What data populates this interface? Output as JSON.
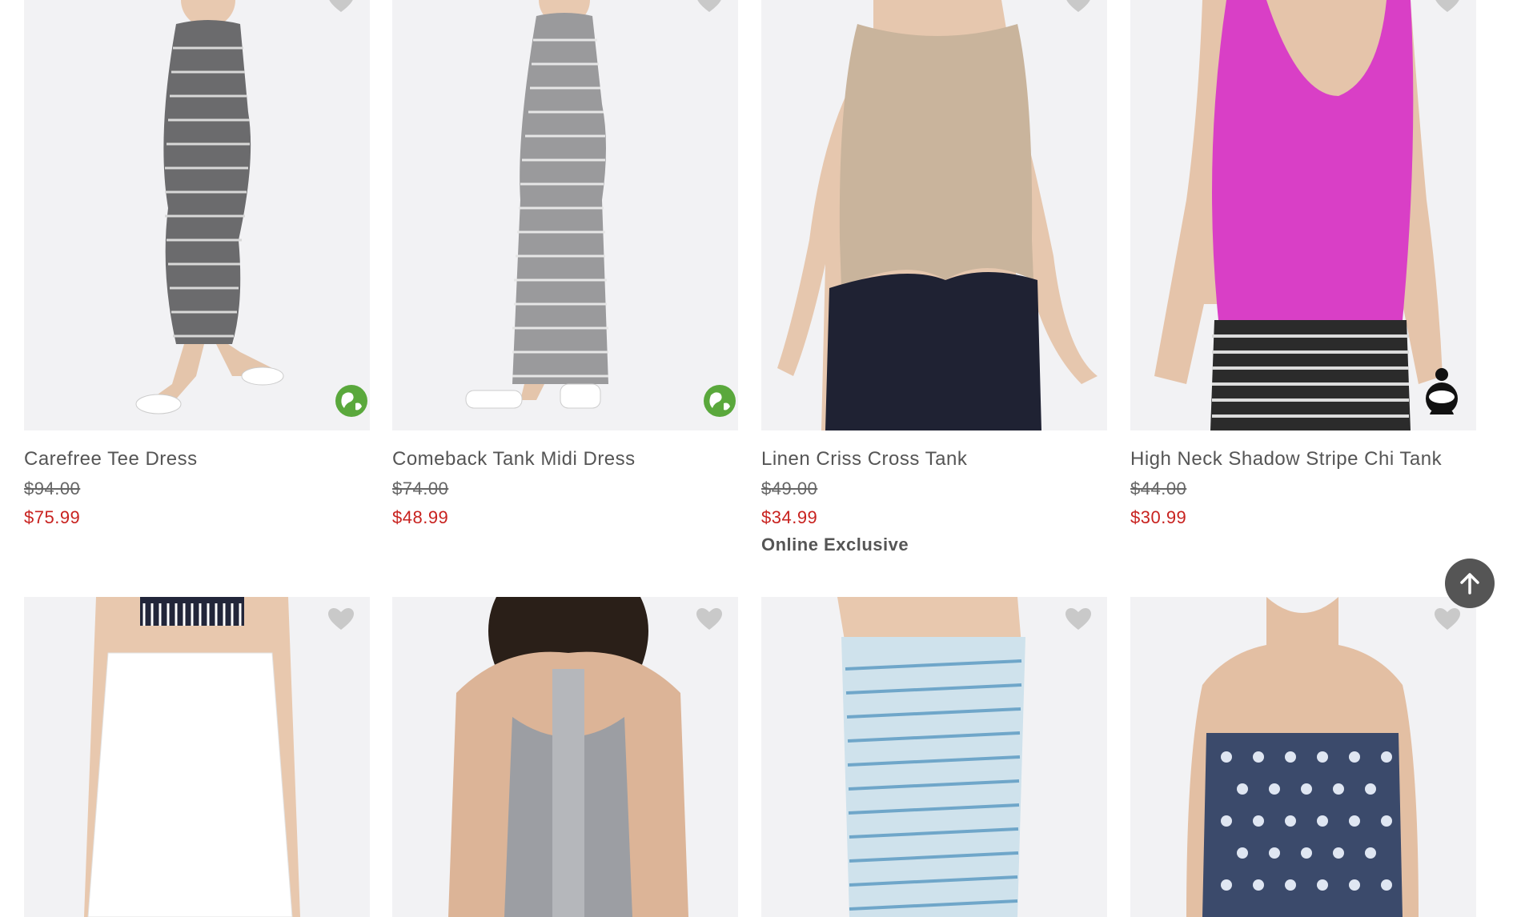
{
  "products_row1": [
    {
      "name": "Carefree Tee Dress",
      "original_price": "$94.00",
      "sale_price": "$75.99",
      "badge": "eco-globe-icon"
    },
    {
      "name": "Comeback Tank Midi Dress",
      "original_price": "$74.00",
      "sale_price": "$48.99",
      "badge": "eco-globe-icon"
    },
    {
      "name": "Linen Criss Cross Tank",
      "original_price": "$49.00",
      "sale_price": "$34.99",
      "tag": "Online Exclusive"
    },
    {
      "name": "High Neck Shadow Stripe Chi Tank",
      "original_price": "$44.00",
      "sale_price": "$30.99",
      "badge": "fair-trade-icon"
    }
  ],
  "colors": {
    "sale": "#c8221f",
    "image_bg": "#f2f2f4",
    "heart": "#c9c9c9",
    "eco_badge": "#5aa83c",
    "back_to_top": "#555555"
  },
  "icons": {
    "favorite": "heart-icon",
    "back_to_top": "arrow-up-icon"
  }
}
